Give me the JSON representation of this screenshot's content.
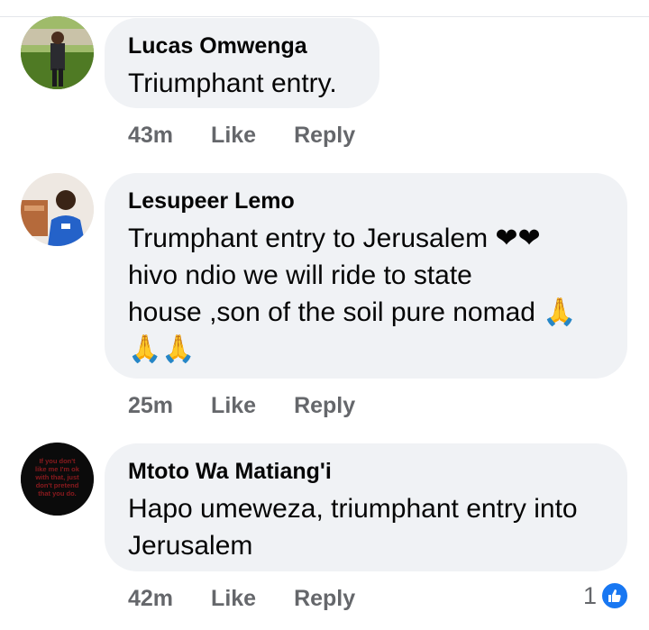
{
  "comments": [
    {
      "author": "Lucas Omwenga",
      "lines": [
        "Triumphant entry."
      ],
      "time": "43m",
      "like": "Like",
      "reply": "Reply"
    },
    {
      "author": "Lesupeer Lemo",
      "lines": [
        "Trumphant entry to Jerusalem ❤❤",
        "hivo ndio we will ride to state",
        "house ,son of the soil pure nomad 🙏",
        "🙏🙏"
      ],
      "time": "25m",
      "like": "Like",
      "reply": "Reply"
    },
    {
      "author": "Mtoto Wa Matiang'i",
      "lines": [
        "Hapo umeweza, triumphant entry into",
        "Jerusalem"
      ],
      "time": "42m",
      "like": "Like",
      "reply": "Reply",
      "reaction_count": "1",
      "reaction_icon": "like-icon",
      "avatar_text": [
        "If you don't",
        "like me I'm ok",
        "with that, just",
        "don't pretend",
        "that you do."
      ]
    }
  ]
}
